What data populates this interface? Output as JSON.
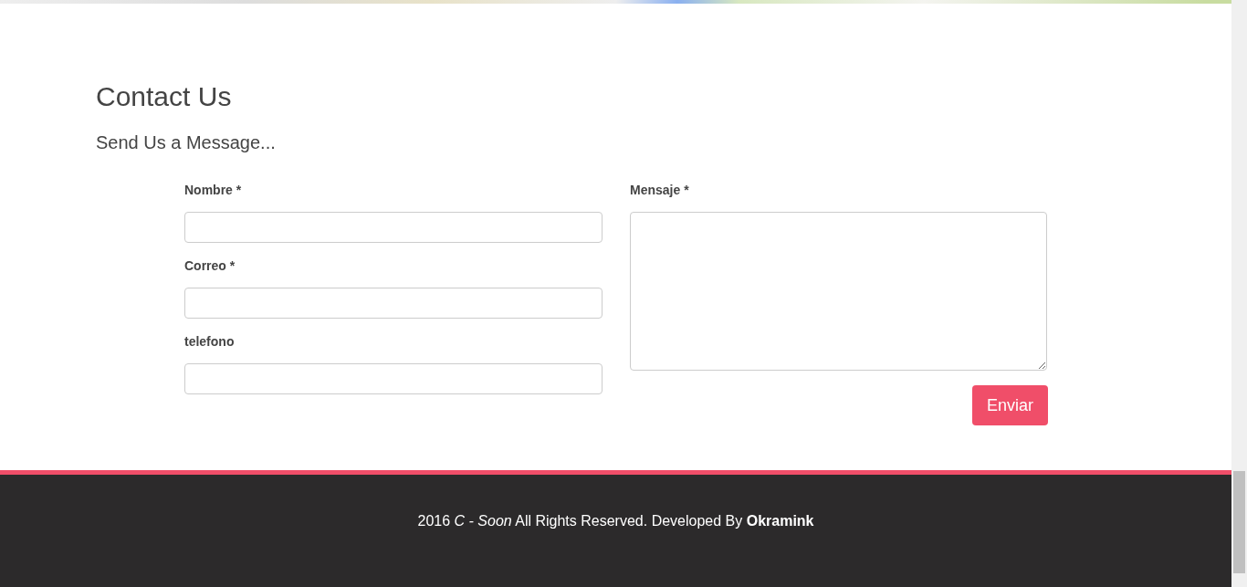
{
  "contact": {
    "title": "Contact Us",
    "subtitle": "Send Us a Message...",
    "fields": [
      {
        "label": "Nombre *",
        "kind": "input"
      },
      {
        "label": "Correo *",
        "kind": "input"
      },
      {
        "label": "telefono",
        "kind": "input"
      }
    ],
    "message": {
      "label": "Mensaje *",
      "kind": "textarea"
    },
    "submit": "Enviar"
  },
  "footer": {
    "text": "2016 *C - Soon* All Rights Reserved. Developed By **Okramink**"
  }
}
